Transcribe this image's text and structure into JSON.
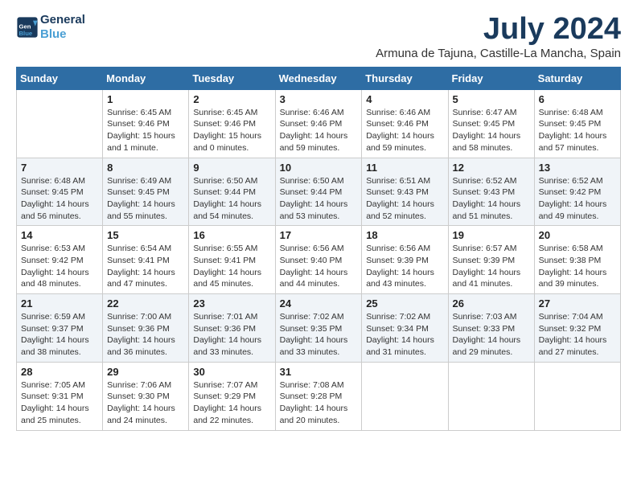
{
  "header": {
    "logo_line1": "General",
    "logo_line2": "Blue",
    "month_title": "July 2024",
    "location": "Armuna de Tajuna, Castille-La Mancha, Spain"
  },
  "days_of_week": [
    "Sunday",
    "Monday",
    "Tuesday",
    "Wednesday",
    "Thursday",
    "Friday",
    "Saturday"
  ],
  "weeks": [
    [
      {
        "day": "",
        "info": ""
      },
      {
        "day": "1",
        "info": "Sunrise: 6:45 AM\nSunset: 9:46 PM\nDaylight: 15 hours\nand 1 minute."
      },
      {
        "day": "2",
        "info": "Sunrise: 6:45 AM\nSunset: 9:46 PM\nDaylight: 15 hours\nand 0 minutes."
      },
      {
        "day": "3",
        "info": "Sunrise: 6:46 AM\nSunset: 9:46 PM\nDaylight: 14 hours\nand 59 minutes."
      },
      {
        "day": "4",
        "info": "Sunrise: 6:46 AM\nSunset: 9:46 PM\nDaylight: 14 hours\nand 59 minutes."
      },
      {
        "day": "5",
        "info": "Sunrise: 6:47 AM\nSunset: 9:45 PM\nDaylight: 14 hours\nand 58 minutes."
      },
      {
        "day": "6",
        "info": "Sunrise: 6:48 AM\nSunset: 9:45 PM\nDaylight: 14 hours\nand 57 minutes."
      }
    ],
    [
      {
        "day": "7",
        "info": "Sunrise: 6:48 AM\nSunset: 9:45 PM\nDaylight: 14 hours\nand 56 minutes."
      },
      {
        "day": "8",
        "info": "Sunrise: 6:49 AM\nSunset: 9:45 PM\nDaylight: 14 hours\nand 55 minutes."
      },
      {
        "day": "9",
        "info": "Sunrise: 6:50 AM\nSunset: 9:44 PM\nDaylight: 14 hours\nand 54 minutes."
      },
      {
        "day": "10",
        "info": "Sunrise: 6:50 AM\nSunset: 9:44 PM\nDaylight: 14 hours\nand 53 minutes."
      },
      {
        "day": "11",
        "info": "Sunrise: 6:51 AM\nSunset: 9:43 PM\nDaylight: 14 hours\nand 52 minutes."
      },
      {
        "day": "12",
        "info": "Sunrise: 6:52 AM\nSunset: 9:43 PM\nDaylight: 14 hours\nand 51 minutes."
      },
      {
        "day": "13",
        "info": "Sunrise: 6:52 AM\nSunset: 9:42 PM\nDaylight: 14 hours\nand 49 minutes."
      }
    ],
    [
      {
        "day": "14",
        "info": "Sunrise: 6:53 AM\nSunset: 9:42 PM\nDaylight: 14 hours\nand 48 minutes."
      },
      {
        "day": "15",
        "info": "Sunrise: 6:54 AM\nSunset: 9:41 PM\nDaylight: 14 hours\nand 47 minutes."
      },
      {
        "day": "16",
        "info": "Sunrise: 6:55 AM\nSunset: 9:41 PM\nDaylight: 14 hours\nand 45 minutes."
      },
      {
        "day": "17",
        "info": "Sunrise: 6:56 AM\nSunset: 9:40 PM\nDaylight: 14 hours\nand 44 minutes."
      },
      {
        "day": "18",
        "info": "Sunrise: 6:56 AM\nSunset: 9:39 PM\nDaylight: 14 hours\nand 43 minutes."
      },
      {
        "day": "19",
        "info": "Sunrise: 6:57 AM\nSunset: 9:39 PM\nDaylight: 14 hours\nand 41 minutes."
      },
      {
        "day": "20",
        "info": "Sunrise: 6:58 AM\nSunset: 9:38 PM\nDaylight: 14 hours\nand 39 minutes."
      }
    ],
    [
      {
        "day": "21",
        "info": "Sunrise: 6:59 AM\nSunset: 9:37 PM\nDaylight: 14 hours\nand 38 minutes."
      },
      {
        "day": "22",
        "info": "Sunrise: 7:00 AM\nSunset: 9:36 PM\nDaylight: 14 hours\nand 36 minutes."
      },
      {
        "day": "23",
        "info": "Sunrise: 7:01 AM\nSunset: 9:36 PM\nDaylight: 14 hours\nand 33 minutes."
      },
      {
        "day": "24",
        "info": "Sunrise: 7:02 AM\nSunset: 9:35 PM\nDaylight: 14 hours\nand 33 minutes."
      },
      {
        "day": "25",
        "info": "Sunrise: 7:02 AM\nSunset: 9:34 PM\nDaylight: 14 hours\nand 31 minutes."
      },
      {
        "day": "26",
        "info": "Sunrise: 7:03 AM\nSunset: 9:33 PM\nDaylight: 14 hours\nand 29 minutes."
      },
      {
        "day": "27",
        "info": "Sunrise: 7:04 AM\nSunset: 9:32 PM\nDaylight: 14 hours\nand 27 minutes."
      }
    ],
    [
      {
        "day": "28",
        "info": "Sunrise: 7:05 AM\nSunset: 9:31 PM\nDaylight: 14 hours\nand 25 minutes."
      },
      {
        "day": "29",
        "info": "Sunrise: 7:06 AM\nSunset: 9:30 PM\nDaylight: 14 hours\nand 24 minutes."
      },
      {
        "day": "30",
        "info": "Sunrise: 7:07 AM\nSunset: 9:29 PM\nDaylight: 14 hours\nand 22 minutes."
      },
      {
        "day": "31",
        "info": "Sunrise: 7:08 AM\nSunset: 9:28 PM\nDaylight: 14 hours\nand 20 minutes."
      },
      {
        "day": "",
        "info": ""
      },
      {
        "day": "",
        "info": ""
      },
      {
        "day": "",
        "info": ""
      }
    ]
  ]
}
